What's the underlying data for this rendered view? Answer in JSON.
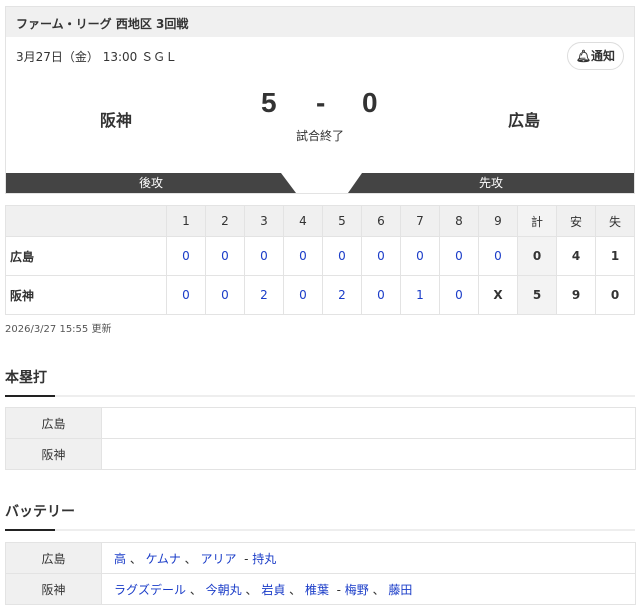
{
  "game": {
    "title": "ファーム・リーグ 西地区 3回戦",
    "date": "3月27日（金） 13:00 ＳＧＬ",
    "notify": "通知",
    "home": "阪神",
    "away": "広島",
    "home_score": "5",
    "sep": "-",
    "away_score": "0",
    "status": "試合終了",
    "home_side": "後攻",
    "away_side": "先攻"
  },
  "linescore": {
    "headers": [
      "1",
      "2",
      "3",
      "4",
      "5",
      "6",
      "7",
      "8",
      "9",
      "計",
      "安",
      "失"
    ],
    "rows": [
      {
        "team": "広島",
        "cells": [
          "0",
          "0",
          "0",
          "0",
          "0",
          "0",
          "0",
          "0",
          "0",
          "0",
          "4",
          "1"
        ]
      },
      {
        "team": "阪神",
        "cells": [
          "0",
          "0",
          "2",
          "0",
          "2",
          "0",
          "1",
          "0",
          "X",
          "5",
          "9",
          "0"
        ]
      }
    ],
    "updated": "2026/3/27 15:55 更新"
  },
  "homeruns": {
    "title": "本塁打",
    "rows": [
      {
        "team": "広島"
      },
      {
        "team": "阪神"
      }
    ]
  },
  "battery": {
    "title": "バッテリー",
    "rows": [
      {
        "team": "広島",
        "pitchers": [
          "高",
          "ケムナ",
          "アリア"
        ],
        "catchers": [
          "持丸"
        ]
      },
      {
        "team": "阪神",
        "pitchers": [
          "ラグズデール",
          "今朝丸",
          "岩貞",
          "椎葉"
        ],
        "catchers": [
          "梅野",
          "藤田"
        ]
      }
    ]
  },
  "separators": {
    "comma": "、",
    "dash": "-"
  }
}
